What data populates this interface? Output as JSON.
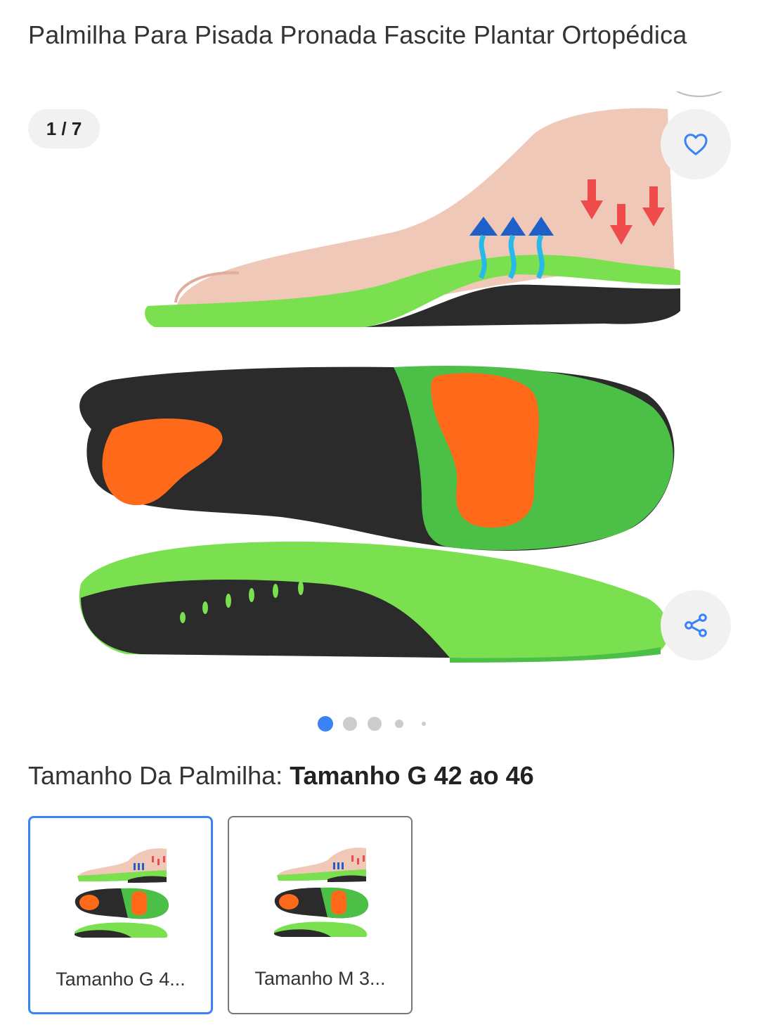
{
  "product": {
    "title": "Palmilha Para Pisada Pronada Fascite Plantar Ortopédica"
  },
  "gallery": {
    "counter": "1 / 7",
    "favorite_icon": "heart-icon",
    "share_icon": "share-icon",
    "current_image": 1,
    "total_images": 7
  },
  "variant": {
    "label": "Tamanho Da Palmilha:",
    "selected_value": "Tamanho G 42 ao 46",
    "options": [
      {
        "label": "Tamanho G 4...",
        "selected": true
      },
      {
        "label": "Tamanho M 3...",
        "selected": false
      }
    ]
  },
  "colors": {
    "accent": "#3b82f6",
    "insole_green": "#6fd64a",
    "insole_dark": "#2b2b2b",
    "insole_orange": "#ff6a1a",
    "arrow_red": "#ef4b4b",
    "arrow_blue": "#1f5fc8"
  }
}
